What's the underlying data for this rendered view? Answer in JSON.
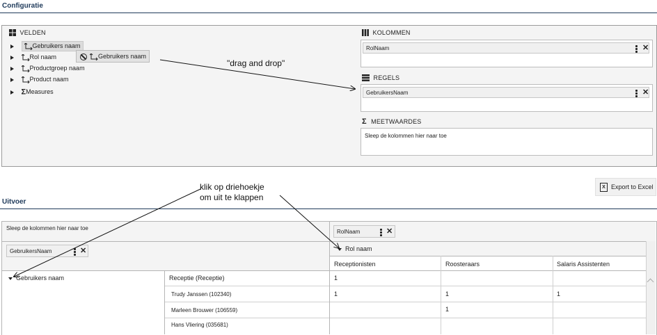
{
  "config": {
    "title": "Configuratie",
    "velden": {
      "header": "VELDEN",
      "items": [
        {
          "label": "Gebruikers naam"
        },
        {
          "label": "Rol naam"
        },
        {
          "label": "Productgroep naam"
        },
        {
          "label": "Product naam"
        },
        {
          "label": "Measures"
        }
      ],
      "drag_ghost": "Gebruikers naam"
    },
    "kolommen": {
      "header": "KOLOMMEN",
      "chip": "RolNaam"
    },
    "regels": {
      "header": "REGELS",
      "chip": "GebruikersNaam"
    },
    "meetwaardes": {
      "header": "MEETWAARDES",
      "placeholder": "Sleep de kolommen hier naar toe"
    }
  },
  "annotations": {
    "drag": "\"drag and drop\"",
    "expand_line1": "klik op driehoekje",
    "expand_line2": "om uit te klappen"
  },
  "export": {
    "label": "Export to Excel"
  },
  "uitvoer": {
    "title": "Uitvoer",
    "filter_placeholder": "Sleep de kolommen hier naar toe",
    "column_chip": "RolNaam",
    "row_chip": "GebruikersNaam",
    "col_group": "Rol naam",
    "columns": [
      "Receptionisten",
      "Roosteraars",
      "Salaris Assistenten"
    ],
    "row_group": "Gebruikers naam",
    "rows": [
      {
        "label": "Receptie (Receptie)",
        "values": [
          "1",
          "",
          ""
        ]
      },
      {
        "label": "Trudy Janssen (102340)",
        "values": [
          "1",
          "1",
          "1"
        ]
      },
      {
        "label": "Marleen Brouwer (106559)",
        "values": [
          "",
          "1",
          ""
        ]
      },
      {
        "label": "Hans Vliering (035681)",
        "values": [
          "",
          "",
          ""
        ]
      }
    ]
  }
}
